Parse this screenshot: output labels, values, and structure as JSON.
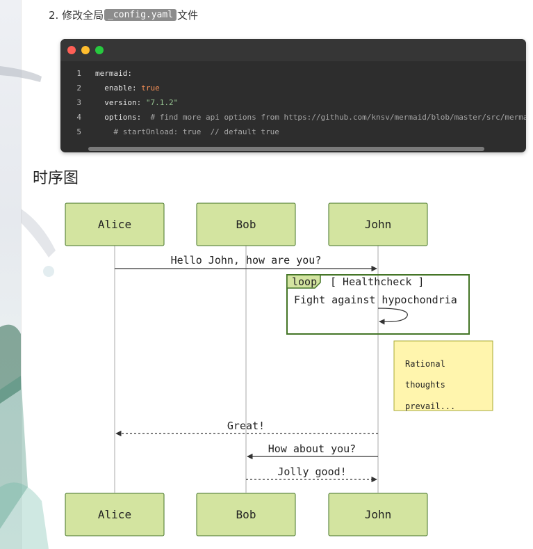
{
  "step": {
    "number": "2.",
    "before": "修改全局",
    "code": "_config.yaml",
    "after": "文件"
  },
  "code_block": {
    "lines": [
      {
        "num": "1",
        "parts": [
          {
            "t": "mermaid:",
            "c": "k"
          }
        ]
      },
      {
        "num": "2",
        "parts": [
          {
            "t": "  enable: ",
            "c": "k"
          },
          {
            "t": "true",
            "c": "bool"
          }
        ]
      },
      {
        "num": "3",
        "parts": [
          {
            "t": "  version: ",
            "c": "k"
          },
          {
            "t": "\"7.1.2\"",
            "c": "str"
          }
        ]
      },
      {
        "num": "4",
        "parts": [
          {
            "t": "  options:  ",
            "c": "k"
          },
          {
            "t": "# find more api options from https://github.com/knsv/mermaid/blob/master/src/mermaidAPI.js",
            "c": "cmt"
          }
        ]
      },
      {
        "num": "5",
        "parts": [
          {
            "t": "    # startOnload: true  // default true",
            "c": "cmt"
          }
        ]
      }
    ]
  },
  "section_title": "时序图",
  "diagram": {
    "actors": [
      "Alice",
      "Bob",
      "John"
    ],
    "messages": {
      "m1": "Hello John, how are you?",
      "m2": "Fight against hypochondria",
      "m3": "Great!",
      "m4": "How about you?",
      "m5": "Jolly good!"
    },
    "loop": {
      "keyword": "loop",
      "label": "[ Healthcheck ]"
    },
    "note": {
      "lines": [
        "Rational",
        "thoughts",
        "prevail..."
      ]
    },
    "colors": {
      "actor_fill": "#d3e4a0",
      "actor_stroke": "#447527",
      "note_fill": "#fff5ad",
      "line": "#333333"
    }
  }
}
